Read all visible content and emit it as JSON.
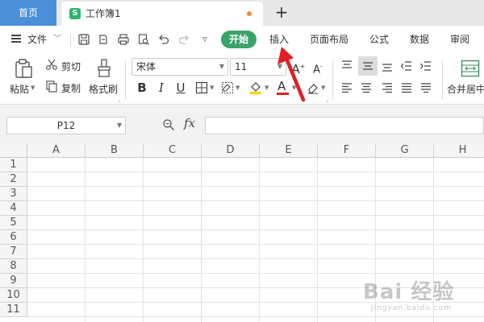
{
  "titlebar": {
    "home_tab": "首页",
    "workbook_tab": "工作簿1",
    "app_badge": "S",
    "new_tab": "+"
  },
  "menubar": {
    "file": "文件",
    "tabs": [
      {
        "label": "开始",
        "active": true
      },
      {
        "label": "插入",
        "active": false
      },
      {
        "label": "页面布局",
        "active": false
      },
      {
        "label": "公式",
        "active": false
      },
      {
        "label": "数据",
        "active": false
      },
      {
        "label": "审阅",
        "active": false
      }
    ],
    "accent_color": "#3aa36a"
  },
  "ribbon": {
    "paste": "粘贴",
    "cut": "剪切",
    "copy": "复制",
    "format_painter": "格式刷",
    "font_name": "宋体",
    "font_size": "11",
    "bold": "B",
    "italic": "I",
    "underline": "U",
    "font_color": "A",
    "merge_center": "合并居中"
  },
  "formulabar": {
    "cell_ref": "P12",
    "fx": "fx",
    "formula_value": ""
  },
  "grid": {
    "columns": [
      "A",
      "B",
      "C",
      "D",
      "E",
      "F",
      "G",
      "H"
    ],
    "rows": [
      "1",
      "2",
      "3",
      "4",
      "5",
      "6",
      "7",
      "8",
      "9",
      "10",
      "11"
    ]
  },
  "watermark": {
    "text": "Bai 经验",
    "sub": "jingyan.baidu.com"
  }
}
